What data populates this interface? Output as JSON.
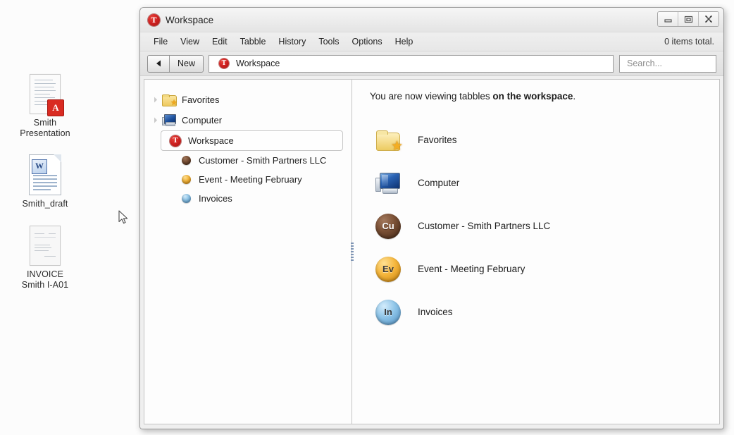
{
  "desktop": {
    "icons": [
      {
        "label_line1": "Smith",
        "label_line2": "Presentation",
        "type": "pdf-document-icon"
      },
      {
        "label_line1": "Smith_draft",
        "label_line2": "",
        "type": "word-document-icon"
      },
      {
        "label_line1": "INVOICE",
        "label_line2": "Smith I-A01",
        "type": "plain-document-icon"
      }
    ]
  },
  "window": {
    "title": "Workspace",
    "app_logo_letter": "T",
    "controls": {
      "minimize": "Minimize",
      "maximize": "Maximize",
      "close": "Close"
    },
    "menu": {
      "items": [
        "File",
        "View",
        "Edit",
        "Tabble",
        "History",
        "Tools",
        "Options",
        "Help"
      ],
      "status": "0 items total."
    },
    "toolbar": {
      "back_label": "Back",
      "new_label": "New",
      "address_value": "Workspace",
      "search_placeholder": "Search...",
      "search_value": ""
    },
    "tree": [
      {
        "label": "Favorites",
        "icon": "favorites-folder-icon",
        "expandable": true,
        "indent": 0,
        "selected": false
      },
      {
        "label": "Computer",
        "icon": "computer-icon",
        "expandable": true,
        "indent": 0,
        "selected": false
      },
      {
        "label": "Workspace",
        "icon": "tabbles-logo-icon",
        "expandable": false,
        "indent": 0,
        "selected": true
      },
      {
        "label": "Customer - Smith Partners LLC",
        "icon": "sphere-brown-icon",
        "abbr": "Cu",
        "expandable": false,
        "indent": 1,
        "selected": false
      },
      {
        "label": "Event - Meeting February",
        "icon": "sphere-amber-icon",
        "abbr": "Ev",
        "expandable": false,
        "indent": 1,
        "selected": false
      },
      {
        "label": "Invoices",
        "icon": "sphere-blue-icon",
        "abbr": "In",
        "expandable": false,
        "indent": 1,
        "selected": false
      }
    ],
    "content": {
      "headline_normal": "You are now viewing tabbles ",
      "headline_bold": "on the workspace",
      "headline_end": ".",
      "items": [
        {
          "label": "Favorites",
          "icon": "favorites-folder-icon",
          "abbr": ""
        },
        {
          "label": "Computer",
          "icon": "computer-icon",
          "abbr": ""
        },
        {
          "label": "Customer - Smith Partners LLC",
          "icon": "sphere-brown-icon",
          "abbr": "Cu"
        },
        {
          "label": "Event - Meeting February",
          "icon": "sphere-amber-icon",
          "abbr": "Ev"
        },
        {
          "label": "Invoices",
          "icon": "sphere-blue-icon",
          "abbr": "In"
        }
      ]
    }
  },
  "colors": {
    "brand_red": "#cf2222",
    "sphere_brown": "#7b5136",
    "sphere_amber": "#f5b63c",
    "sphere_blue": "#8dc4e8",
    "folder_yellow": "#eec95e",
    "desktop_bg": "#fcfcfc",
    "window_chrome": "#efefef"
  }
}
